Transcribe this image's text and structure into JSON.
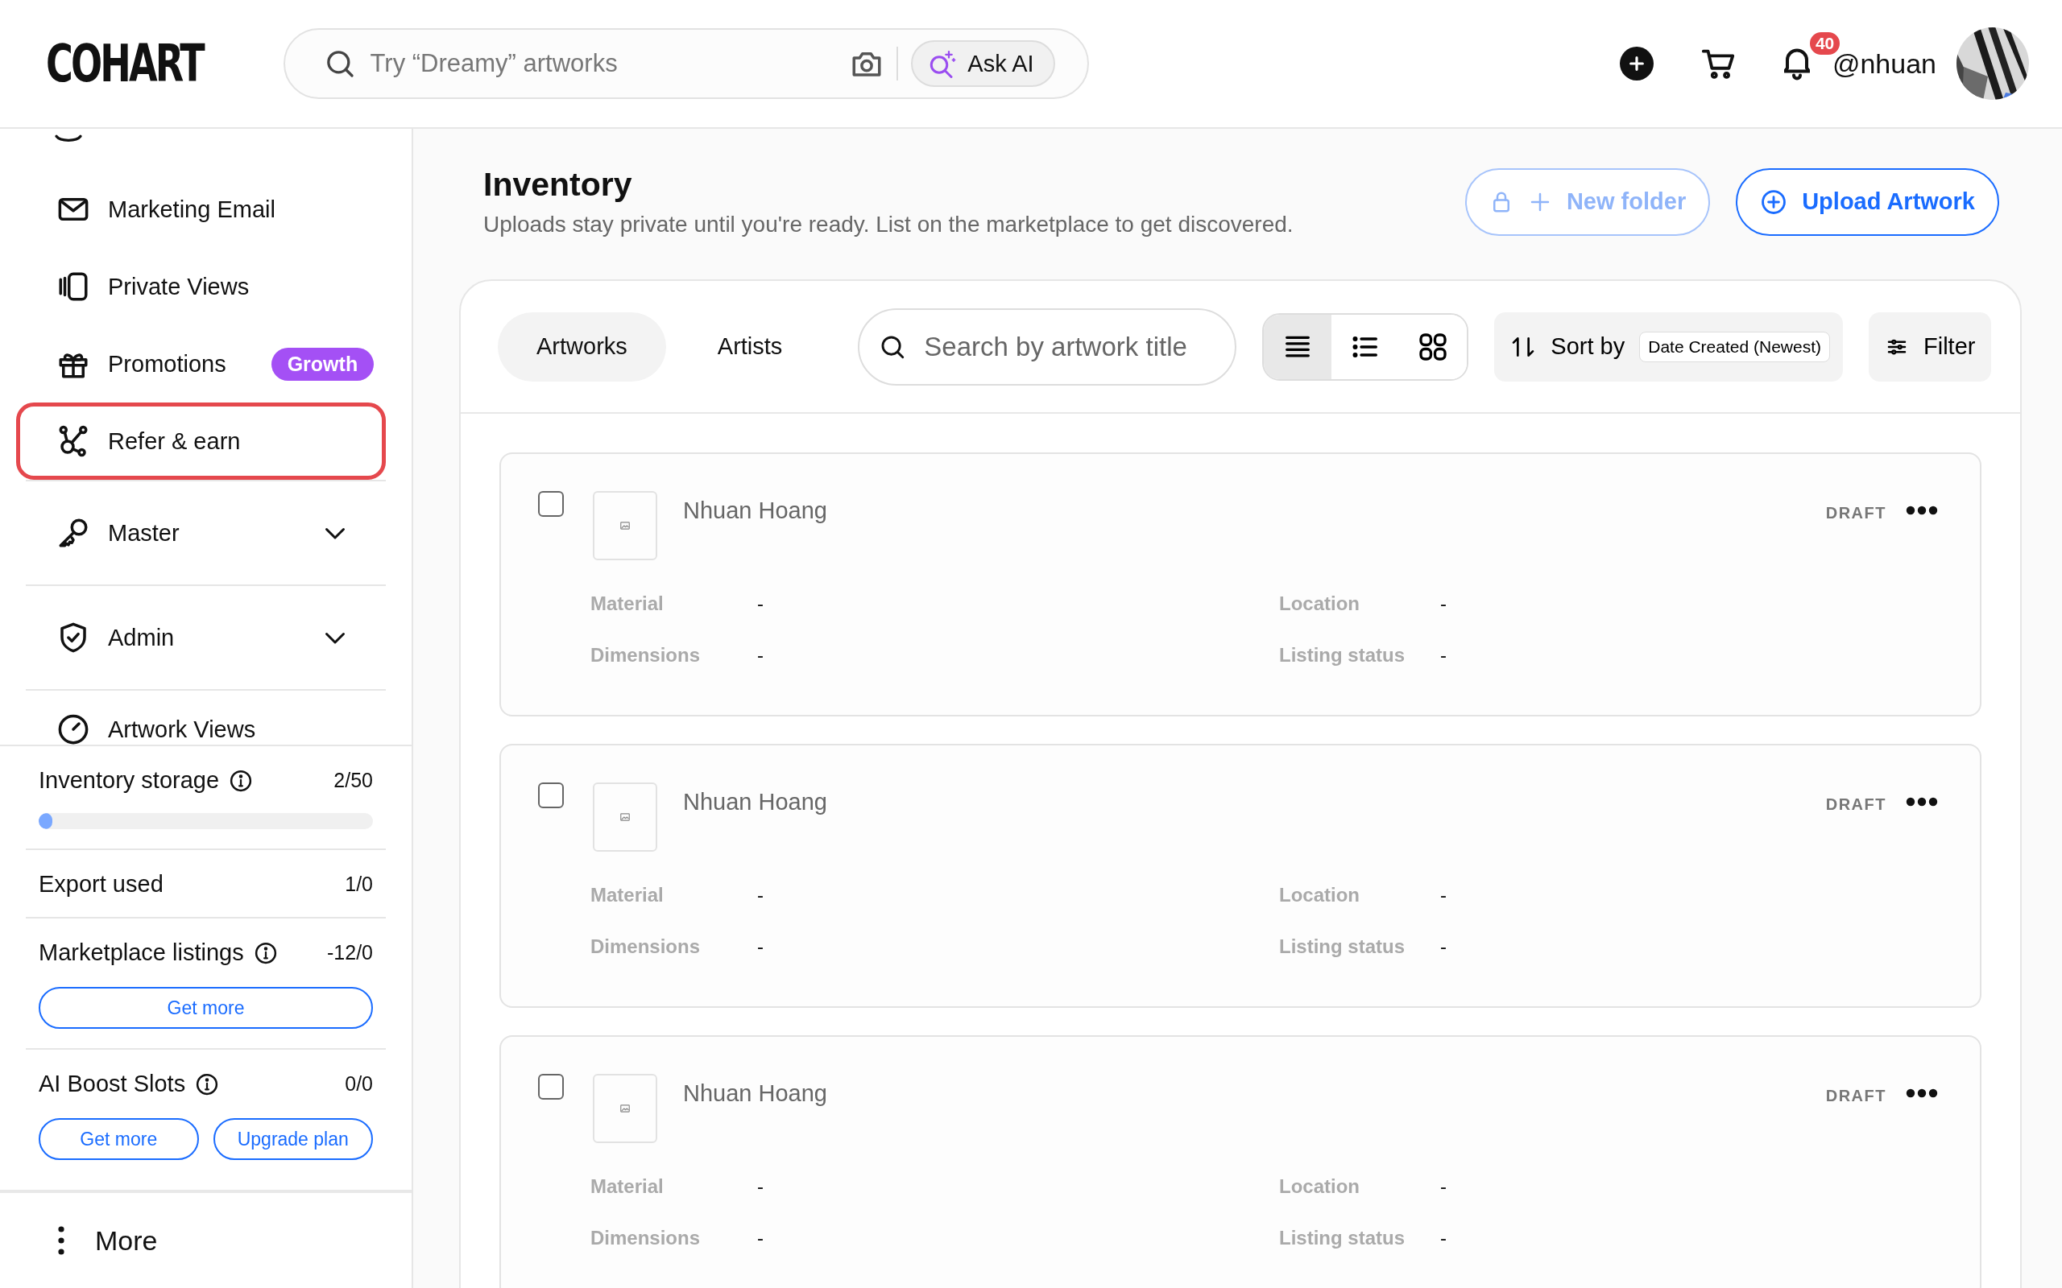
{
  "header": {
    "logo": "COHART",
    "search": {
      "placeholder": "Try “Dreamy” artworks"
    },
    "ask_ai": "Ask AI",
    "notifications": {
      "count": "40"
    },
    "username": "@nhuan"
  },
  "sidebar": {
    "items": [
      {
        "label": "Marketing Email",
        "kind": "link",
        "selected": false
      },
      {
        "label": "Private Views",
        "kind": "link",
        "selected": false
      },
      {
        "label": "Promotions",
        "kind": "link",
        "selected": false,
        "badge": "Growth"
      },
      {
        "label": "Refer & earn",
        "kind": "link",
        "selected": true
      },
      {
        "label": "Master",
        "kind": "group",
        "selected": false,
        "expanded": false
      },
      {
        "label": "Admin",
        "kind": "group",
        "selected": false,
        "expanded": false
      },
      {
        "label": "Artwork Views",
        "kind": "link",
        "selected": false
      }
    ],
    "usage": [
      {
        "label": "Inventory storage",
        "info": true,
        "value": "2/50",
        "level": 0.04
      },
      {
        "label": "Export used",
        "info": false,
        "value": "1/0"
      },
      {
        "label": "Marketplace listings",
        "info": true,
        "value": "-12/0",
        "buttons": [
          "Get more"
        ]
      },
      {
        "label": "AI Boost Slots",
        "info": true,
        "value": "0/0",
        "buttons": [
          "Get more",
          "Upgrade plan"
        ]
      }
    ],
    "more": "More"
  },
  "page": {
    "title": "Inventory",
    "subtitle": "Uploads stay private until you're ready. List on the marketplace to get discovered.",
    "new_folder": {
      "label": "New folder",
      "disabled": true
    },
    "upload": {
      "label": "Upload Artwork"
    }
  },
  "toolbar": {
    "tabs": [
      {
        "label": "Artworks",
        "selected": true
      },
      {
        "label": "Artists",
        "selected": false
      }
    ],
    "search": {
      "placeholder": "Search by artwork title"
    },
    "view_modes": [
      {
        "selected": true
      },
      {
        "selected": false
      },
      {
        "selected": false
      }
    ],
    "sort": {
      "label": "Sort by",
      "value": "Date Created (Newest)"
    },
    "filter": "Filter"
  },
  "cards": [
    {
      "name": "Nhuan Hoang",
      "status": "DRAFT",
      "checked": false,
      "fields": [
        {
          "label": "Material",
          "value": "-"
        },
        {
          "label": "Location",
          "value": "-"
        },
        {
          "label": "Dimensions",
          "value": "-"
        },
        {
          "label": "Listing status",
          "value": "-"
        }
      ]
    },
    {
      "name": "Nhuan Hoang",
      "status": "DRAFT",
      "checked": false,
      "fields": [
        {
          "label": "Material",
          "value": "-"
        },
        {
          "label": "Location",
          "value": "-"
        },
        {
          "label": "Dimensions",
          "value": "-"
        },
        {
          "label": "Listing status",
          "value": "-"
        }
      ]
    },
    {
      "name": "Nhuan Hoang",
      "status": "DRAFT",
      "checked": false,
      "fields": [
        {
          "label": "Material",
          "value": "-"
        },
        {
          "label": "Location",
          "value": "-"
        },
        {
          "label": "Dimensions",
          "value": "-"
        },
        {
          "label": "Listing status",
          "value": "-"
        }
      ]
    }
  ]
}
